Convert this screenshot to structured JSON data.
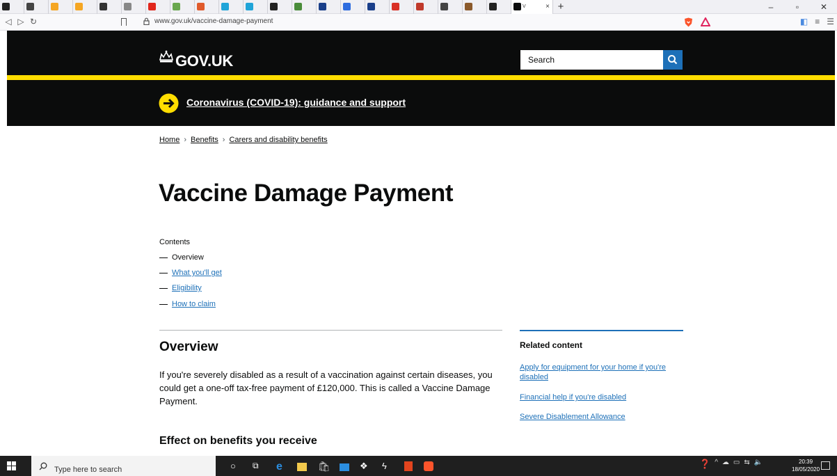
{
  "browser": {
    "tabs": [
      {
        "title": "",
        "color": "#222222"
      },
      {
        "title": "",
        "color": "#444444"
      },
      {
        "title": "",
        "color": "#f5a623"
      },
      {
        "title": "",
        "color": "#f5a623"
      },
      {
        "title": "",
        "color": "#333333"
      },
      {
        "title": "",
        "color": "#888888"
      },
      {
        "title": "",
        "color": "#e1261c"
      },
      {
        "title": "",
        "color": "#6aa84f"
      },
      {
        "title": "",
        "color": "#e05a2b"
      },
      {
        "title": "",
        "color": "#20a4d8"
      },
      {
        "title": "",
        "color": "#20a4d8"
      },
      {
        "title": "",
        "color": "#222222"
      },
      {
        "title": "",
        "color": "#4a8c3a"
      },
      {
        "title": "",
        "color": "#1a3f8a"
      },
      {
        "title": "",
        "color": "#2d6cdf"
      },
      {
        "title": "",
        "color": "#1a3f8a"
      },
      {
        "title": "",
        "color": "#d93025"
      },
      {
        "title": "",
        "color": "#c0392b"
      },
      {
        "title": "",
        "color": "#444444"
      },
      {
        "title": "",
        "color": "#8b5a2b"
      },
      {
        "title": "",
        "color": "#222222"
      }
    ],
    "active_tab": {
      "title": "V"
    },
    "url": "www.gov.uk/vaccine-damage-payment"
  },
  "header": {
    "logo": "GOV.UK",
    "search_label": "Search"
  },
  "banner": {
    "link": "Coronavirus (COVID-19): guidance and support"
  },
  "breadcrumb": [
    "Home",
    "Benefits",
    "Carers and disability benefits"
  ],
  "main": {
    "title": "Vaccine Damage Payment",
    "contents_label": "Contents",
    "contents": [
      {
        "label": "Overview",
        "current": true
      },
      {
        "label": "What you'll get",
        "current": false
      },
      {
        "label": "Eligibility",
        "current": false
      },
      {
        "label": "How to claim",
        "current": false
      }
    ],
    "overview_heading": "Overview",
    "overview_text": "If you're severely disabled as a result of a vaccination against certain diseases, you could get a one-off tax-free payment of £120,000. This is called a Vaccine Damage Payment.",
    "effect_heading": "Effect on benefits you receive"
  },
  "related": {
    "heading": "Related content",
    "links": [
      "Apply for equipment for your home if you're disabled",
      "Financial help if you're disabled",
      "Severe Disablement Allowance"
    ]
  },
  "taskbar": {
    "search_placeholder": "Type here to search",
    "time": "20:39",
    "date": "18/05/2020"
  },
  "colors": {
    "govuk_black": "#0b0c0c",
    "govuk_yellow": "#ffdd00",
    "govuk_blue": "#1d70b8"
  }
}
